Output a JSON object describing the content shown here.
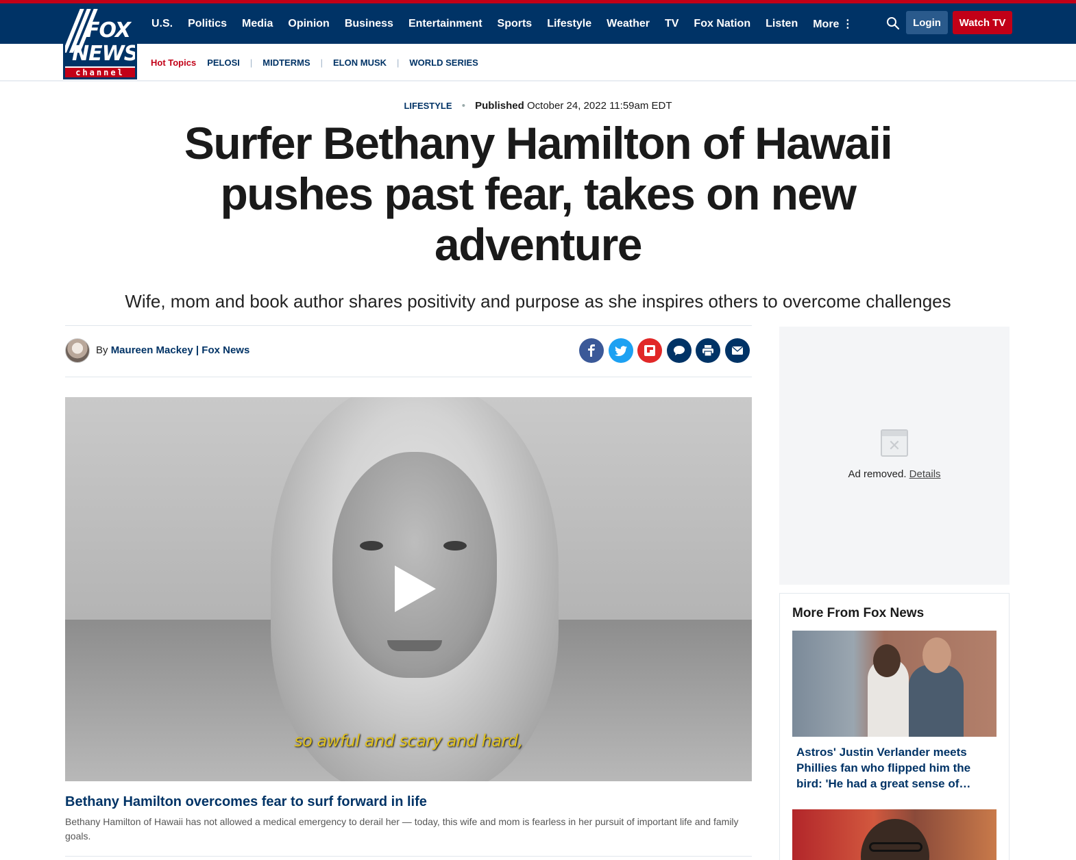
{
  "header": {
    "logo": {
      "top_word": "FOX",
      "bottom_word": "NEWS",
      "sub_word": "channel"
    },
    "nav_items": [
      "U.S.",
      "Politics",
      "Media",
      "Opinion",
      "Business",
      "Entertainment",
      "Sports",
      "Lifestyle",
      "Weather",
      "TV",
      "Fox Nation",
      "Listen",
      "More ⋮"
    ],
    "login_label": "Login",
    "watch_label": "Watch TV",
    "hot_topics_label": "Hot Topics",
    "hot_topics": [
      "PELOSI",
      "MIDTERMS",
      "ELON MUSK",
      "WORLD SERIES"
    ]
  },
  "article": {
    "eyebrow": "LIFESTYLE",
    "published_label": "Published",
    "published_date": "October 24, 2022 11:59am EDT",
    "headline": "Surfer Bethany Hamilton of Hawaii pushes past fear, takes on new adventure",
    "subhead": "Wife, mom and book author shares positivity and purpose as she inspires others to overcome challenges",
    "byline_prefix": "By",
    "author": "Maureen Mackey | Fox News",
    "share_icons": [
      "facebook-icon",
      "twitter-icon",
      "flipboard-icon",
      "comment-icon",
      "print-icon",
      "email-icon"
    ],
    "video": {
      "subtitle": "so awful and scary and hard,",
      "title": "Bethany Hamilton overcomes fear to surf forward in life",
      "description": "Bethany Hamilton of Hawaii has not allowed a medical emergency to derail her — today, this wife and mom is fearless in her pursuit of important life and family goals."
    }
  },
  "sidebar": {
    "ad_text": "Ad removed.",
    "ad_details": "Details",
    "more_title": "More From Fox News",
    "stories": [
      {
        "title": "Astros' Justin Verlander meets Phillies fan who flipped him the bird: 'He had a great sense of…"
      }
    ]
  },
  "colors": {
    "navy": "#003366",
    "red": "#c20017",
    "facebook": "#3b5998",
    "twitter": "#1da1f2",
    "flipboard": "#e12828",
    "dark_blue": "#003366"
  }
}
